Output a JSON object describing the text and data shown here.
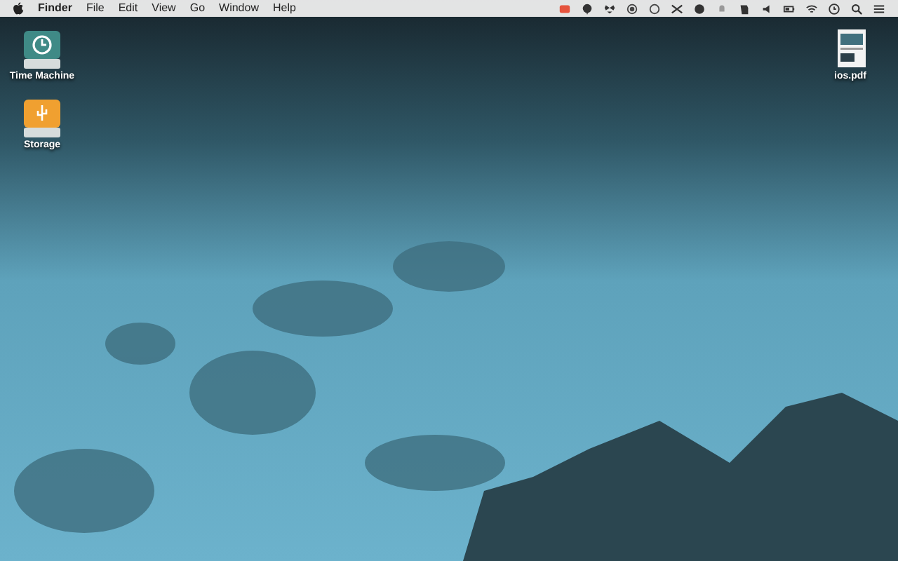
{
  "menu_bar": {
    "items": [
      {
        "label": "Finder",
        "kind": "app"
      },
      {
        "label": "File",
        "kind": "menu"
      },
      {
        "label": "Edit",
        "kind": "menu"
      },
      {
        "label": "View",
        "kind": "menu"
      },
      {
        "label": "Go",
        "kind": "menu"
      },
      {
        "label": "Window",
        "kind": "menu"
      },
      {
        "label": "Help",
        "kind": "menu"
      }
    ]
  },
  "desktop_icons": [
    {
      "label": "Time Machine",
      "kind": "time-machine"
    },
    {
      "label": "Storage",
      "kind": "usb-drive"
    },
    {
      "label": "ios.pdf",
      "kind": "pdf-document"
    }
  ]
}
